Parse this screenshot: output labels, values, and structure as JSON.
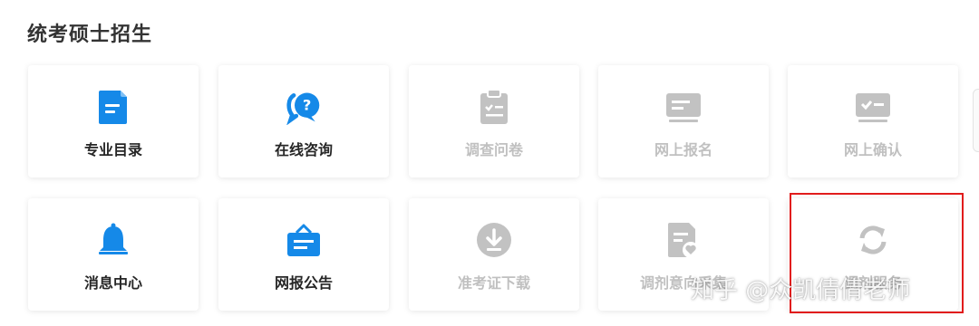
{
  "section": {
    "title": "统考硕士招生"
  },
  "colors": {
    "active": "#1589e8",
    "disabled": "#c2c2c2",
    "highlight": "#e11c1c"
  },
  "cards": [
    {
      "label": "专业目录",
      "icon": "document-icon",
      "enabled": true
    },
    {
      "label": "在线咨询",
      "icon": "question-chat-icon",
      "enabled": true
    },
    {
      "label": "调查问卷",
      "icon": "clipboard-check-icon",
      "enabled": false
    },
    {
      "label": "网上报名",
      "icon": "monitor-form-icon",
      "enabled": false
    },
    {
      "label": "网上确认",
      "icon": "monitor-check-icon",
      "enabled": false
    },
    {
      "label": "消息中心",
      "icon": "bell-icon",
      "enabled": true
    },
    {
      "label": "网报公告",
      "icon": "notice-board-icon",
      "enabled": true
    },
    {
      "label": "准考证下载",
      "icon": "download-icon",
      "enabled": false
    },
    {
      "label": "调剂意向采集",
      "icon": "document-heart-icon",
      "enabled": false
    },
    {
      "label": "调剂服务",
      "icon": "refresh-icon",
      "enabled": false,
      "highlighted": true
    }
  ],
  "watermark": "知乎 @众凯倩倩老师"
}
